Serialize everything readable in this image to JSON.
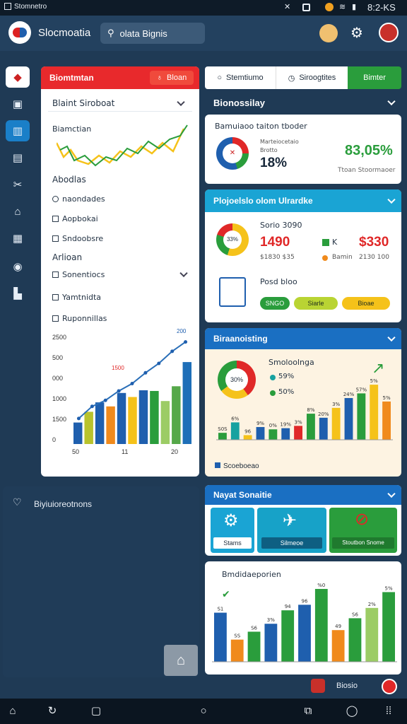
{
  "status": {
    "left_text": "Stomnetro",
    "time": "8:2-KS"
  },
  "app": {
    "title": "Slocmoatia",
    "search_value": "olata Bignis"
  },
  "left_card": {
    "header": "Biomtmtan",
    "header_button": "Bloan",
    "select_label": "Blaint Siroboat",
    "chart_label": "Biamctian",
    "section_label": "Abodlas",
    "items": [
      "naondades",
      "Aopbokai",
      "Sndoobsre"
    ],
    "section2_label": "Arlioan",
    "items2": [
      "Sonentiocs",
      "Yamtnidta",
      "Ruponnillas"
    ]
  },
  "combo": {
    "yticks": [
      "2500",
      "500",
      "000",
      "1000",
      "1500",
      "0"
    ],
    "xticks": [
      "50",
      "11",
      "20"
    ],
    "top_label": "200",
    "mid_label": "1500",
    "bars": [
      {
        "name": "b1",
        "value": 320,
        "color": "#1f5fae"
      },
      {
        "name": "b2",
        "value": 480,
        "color": "#b9c32d"
      },
      {
        "name": "b3",
        "value": 620,
        "color": "#1f5fae"
      },
      {
        "name": "b4",
        "value": 560,
        "color": "#f08a1c"
      },
      {
        "name": "b5",
        "value": 760,
        "color": "#1f5fae"
      },
      {
        "name": "b6",
        "value": 700,
        "color": "#f5c21a"
      },
      {
        "name": "b7",
        "value": 800,
        "color": "#1f5fae"
      },
      {
        "name": "b8",
        "value": 790,
        "color": "#2a9d3c"
      },
      {
        "name": "b9",
        "value": 640,
        "color": "#9ccc65"
      },
      {
        "name": "b10",
        "value": 860,
        "color": "#56a84a"
      },
      {
        "name": "b11",
        "value": 1220,
        "color": "#1e6fb8"
      }
    ],
    "line": [
      380,
      560,
      650,
      790,
      900,
      1060,
      1200,
      1380,
      1520
    ],
    "ymax": 1600
  },
  "tabs": {
    "t1": "Stemtiumo",
    "t2": "Siroogtites",
    "t3": "Bimter"
  },
  "biz": {
    "title": "Bionossilay",
    "card_title": "Bamuiaoo taiton tboder",
    "sub1": "Marteiocetaio",
    "sub2": "Brotto",
    "value": "18%",
    "pct": "83,05%",
    "foot": "Ttoan Stoormaoer"
  },
  "analytics": {
    "title": "Plojoelslo olom Ulrardke",
    "label": "Sorio 3090",
    "v1": "1490",
    "v2": "$330",
    "leg1": "K",
    "leg2": "Bamin",
    "sub_left": "$1830 $35",
    "sub_right": "2130 100",
    "donut_label": "33%",
    "icon_label": "Posd bloo",
    "pills": [
      "SNGO",
      "Siarle",
      "Bioae"
    ]
  },
  "briefing": {
    "title": "Biraanoisting",
    "legend_title": "Smoloolnga",
    "leg1": "59%",
    "leg2": "50%",
    "donut": "30%",
    "foot": "Scoeboeao",
    "bars": [
      {
        "value": 12,
        "color": "#2a9d3c"
      },
      {
        "value": 30,
        "color": "#17a2a0"
      },
      {
        "value": 8,
        "color": "#f5c21a"
      },
      {
        "value": 22,
        "color": "#1f5fae"
      },
      {
        "value": 18,
        "color": "#2a9d3c"
      },
      {
        "value": 20,
        "color": "#1f5fae"
      },
      {
        "value": 24,
        "color": "#e02828"
      },
      {
        "value": 45,
        "color": "#2a9d3c"
      },
      {
        "value": 38,
        "color": "#1f5fae"
      },
      {
        "value": 55,
        "color": "#f5c21a"
      },
      {
        "value": 72,
        "color": "#1f5fae"
      },
      {
        "value": 80,
        "color": "#2a9d3c"
      },
      {
        "value": 95,
        "color": "#f5c21a"
      },
      {
        "value": 66,
        "color": "#f08a1c"
      }
    ],
    "labels": [
      "S0S",
      "6%",
      "96",
      "9%",
      "0%",
      "19%",
      "3%",
      "8%",
      "20%",
      "3%",
      "24%",
      "57%",
      "5%",
      "5%"
    ]
  },
  "side_widget": {
    "label": "Biyiuioreotnons"
  },
  "nav_settings": {
    "title": "Nayat Sonaitie",
    "tile1": "Stams",
    "tile2": "Silmeoe",
    "tile3": "Stoutbon Snome"
  },
  "bottom_chart": {
    "title": "Bmdidaeporien",
    "bars": [
      {
        "value": 62,
        "color": "#1f5fae"
      },
      {
        "value": 28,
        "color": "#f08a1c"
      },
      {
        "value": 38,
        "color": "#2a9d3c"
      },
      {
        "value": 48,
        "color": "#1f5fae"
      },
      {
        "value": 65,
        "color": "#2a9d3c"
      },
      {
        "value": 72,
        "color": "#1f5fae"
      },
      {
        "value": 92,
        "color": "#2a9d3c"
      },
      {
        "value": 40,
        "color": "#f08a1c"
      },
      {
        "value": 55,
        "color": "#2a9d3c"
      },
      {
        "value": 68,
        "color": "#9ccc65"
      },
      {
        "value": 88,
        "color": "#2a9d3c"
      }
    ],
    "labels": [
      "S1",
      "SS",
      "S6",
      "3%",
      "94",
      "96",
      "%0",
      "49",
      "S6",
      "2%",
      "5%"
    ]
  },
  "footer": {
    "label": "Biosio"
  }
}
